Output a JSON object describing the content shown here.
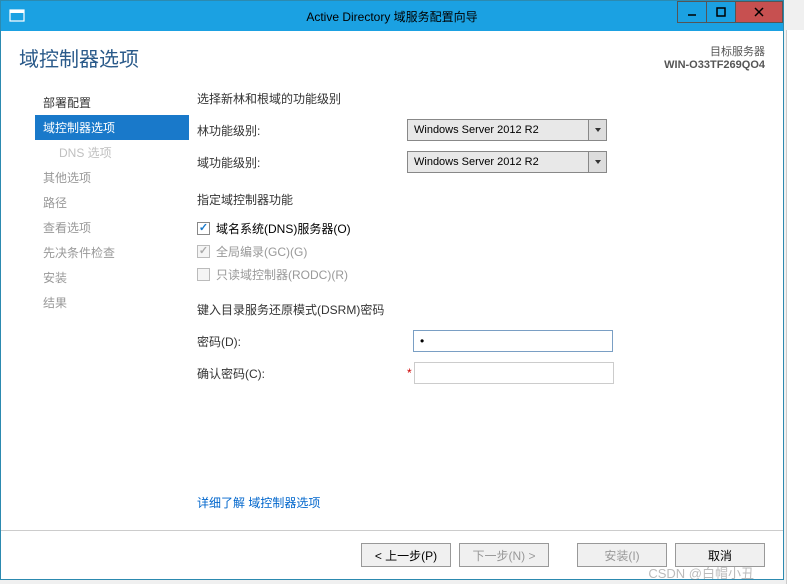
{
  "titlebar": {
    "title": "Active Directory 域服务配置向导"
  },
  "header": {
    "page_title": "域控制器选项",
    "server_label": "目标服务器",
    "server_name": "WIN-O33TF269QO4"
  },
  "sidebar": {
    "items": [
      {
        "label": "部署配置",
        "state": "completed"
      },
      {
        "label": "域控制器选项",
        "state": "active"
      },
      {
        "label": "DNS 选项",
        "state": "sub"
      },
      {
        "label": "其他选项",
        "state": "disabled"
      },
      {
        "label": "路径",
        "state": "disabled"
      },
      {
        "label": "查看选项",
        "state": "disabled"
      },
      {
        "label": "先决条件检查",
        "state": "disabled"
      },
      {
        "label": "安装",
        "state": "disabled"
      },
      {
        "label": "结果",
        "state": "disabled"
      }
    ]
  },
  "form": {
    "section1_title": "选择新林和根域的功能级别",
    "forest_level_label": "林功能级别:",
    "forest_level_value": "Windows Server 2012 R2",
    "domain_level_label": "域功能级别:",
    "domain_level_value": "Windows Server 2012 R2",
    "section2_title": "指定域控制器功能",
    "dns_checkbox": "域名系统(DNS)服务器(O)",
    "gc_checkbox": "全局编录(GC)(G)",
    "rodc_checkbox": "只读域控制器(RODC)(R)",
    "section3_title": "键入目录服务还原模式(DSRM)密码",
    "password_label": "密码(D):",
    "password_value": "•",
    "confirm_label": "确认密码(C):",
    "link_text": "详细了解 域控制器选项"
  },
  "footer": {
    "prev": "< 上一步(P)",
    "next": "下一步(N) >",
    "install": "安装(I)",
    "cancel": "取消"
  },
  "watermark": "CSDN @白帽小丑"
}
